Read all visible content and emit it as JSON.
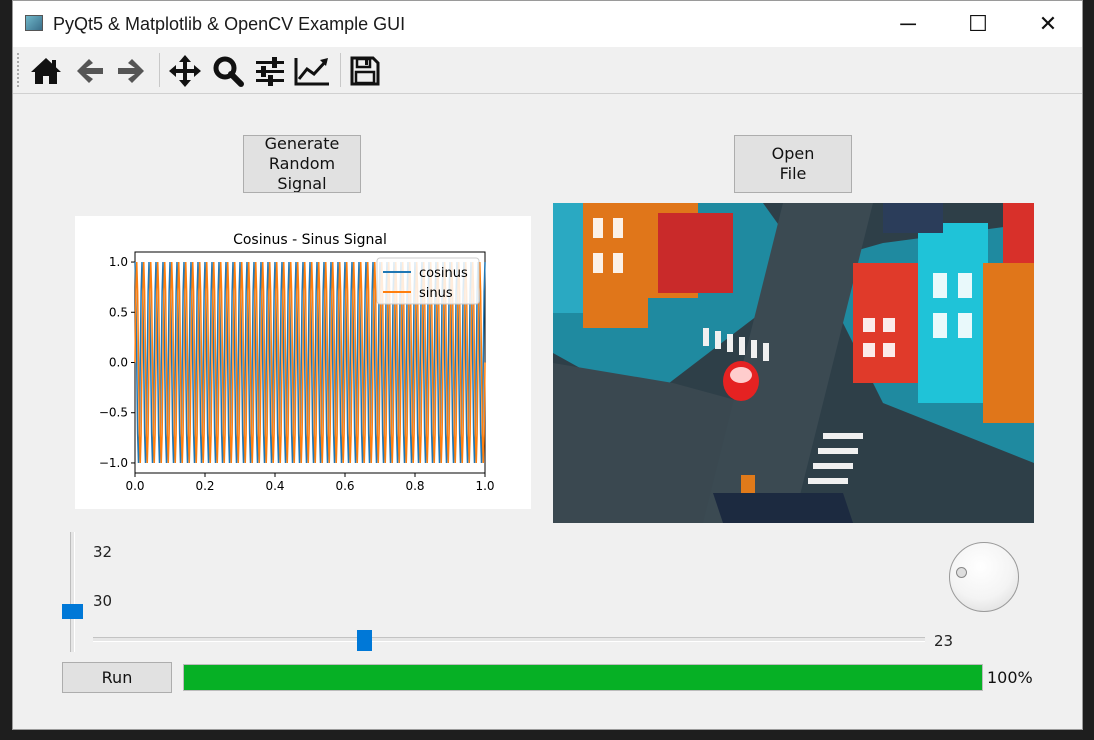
{
  "window": {
    "title": "PyQt5 & Matplotlib & OpenCV Example GUI",
    "controls": {
      "minimize": "─",
      "maximize": "☐",
      "close": "✕"
    }
  },
  "toolbar": {
    "buttons": [
      "home-icon",
      "back-arrow-icon",
      "forward-arrow-icon",
      "pan-move-icon",
      "zoom-magnifier-icon",
      "configure-subplots-icon",
      "edit-axis-icon",
      "save-floppy-icon"
    ]
  },
  "buttons": {
    "generate": "Generate\nRandom\nSignal",
    "open_file": "Open\nFile",
    "run": "Run"
  },
  "vertical_slider": {
    "max_label": "32",
    "value_label": "30",
    "value": 30,
    "max": 32
  },
  "horizontal_slider": {
    "value_label": "23",
    "value": 23
  },
  "progress": {
    "value": 100,
    "text": "100%",
    "color": "#06b025"
  },
  "image": {
    "description": "city-street-intersection-illustration"
  },
  "chart_data": {
    "type": "line",
    "title": "Cosinus - Sinus Signal",
    "xlim": [
      0.0,
      1.0
    ],
    "ylim": [
      -1.1,
      1.1
    ],
    "xticks": [
      "0.0",
      "0.2",
      "0.4",
      "0.6",
      "0.8",
      "1.0"
    ],
    "yticks": [
      "−1.0",
      "−0.5",
      "0.0",
      "0.5",
      "1.0"
    ],
    "xtick_values": [
      0.0,
      0.2,
      0.4,
      0.6,
      0.8,
      1.0
    ],
    "ytick_values": [
      -1.0,
      -0.5,
      0.0,
      0.5,
      1.0
    ],
    "legend_position": "top-right",
    "frequency_hz": 50,
    "series": [
      {
        "name": "cosinus",
        "function": "cos",
        "color": "#1f77b4"
      },
      {
        "name": "sinus",
        "function": "sin",
        "color": "#ff7f0e"
      }
    ]
  }
}
